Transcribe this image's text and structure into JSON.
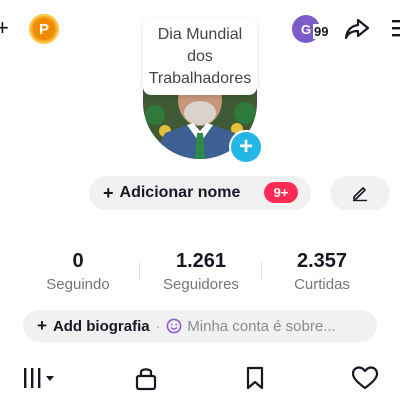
{
  "top_bar": {
    "add_symbol": "+",
    "points_letter": "P",
    "avatar_letter": "G",
    "notification_count": "99"
  },
  "tooltip": {
    "text": "Dia Mundial dos Trabalhadores"
  },
  "profile": {
    "add_name_label": "Adicionar nome",
    "name_badge": "9+"
  },
  "stats": [
    {
      "value": "0",
      "label": "Seguindo"
    },
    {
      "value": "1.261",
      "label": "Seguidores"
    },
    {
      "value": "2.357",
      "label": "Curtidas"
    }
  ],
  "bio": {
    "add_label": "Add biografia",
    "separator": "·",
    "placeholder": "Minha conta é sobre..."
  },
  "colors": {
    "accent_red": "#fe2c55",
    "add_blue": "#25b6e8",
    "points_orange": "#f08a00"
  }
}
